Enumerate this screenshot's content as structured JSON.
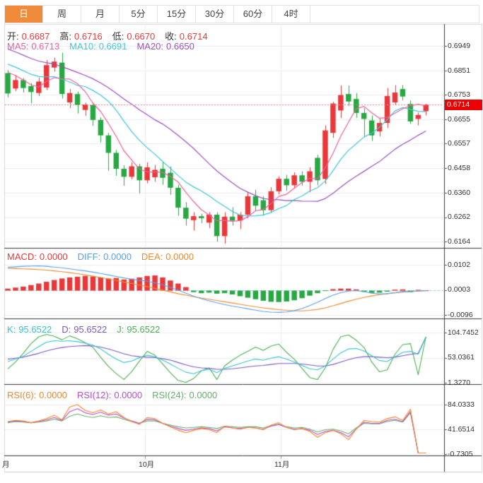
{
  "tabs": [
    {
      "label": "日",
      "selected": true
    },
    {
      "label": "周",
      "selected": false
    },
    {
      "label": "月",
      "selected": false
    },
    {
      "label": "5分",
      "selected": false
    },
    {
      "label": "15分",
      "selected": false
    },
    {
      "label": "30分",
      "selected": false
    },
    {
      "label": "60分",
      "selected": false
    },
    {
      "label": "4时",
      "selected": false
    }
  ],
  "main_panel": {
    "ohlc": {
      "open_label": "开:",
      "open": "0.6687",
      "high_label": "高:",
      "high": "0.6716",
      "low_label": "低:",
      "low": "0.6670",
      "close_label": "收:",
      "close": "0.6714"
    },
    "ma": {
      "ma5_label": "MA5:",
      "ma5": "0.6713",
      "ma10_label": "MA10:",
      "ma10": "0.6691",
      "ma20_label": "MA20:",
      "ma20": "0.6650"
    },
    "axis": [
      "0.6949",
      "0.6851",
      "0.6753",
      "0.6655",
      "0.6557",
      "0.6458",
      "0.6360",
      "0.6262",
      "0.6164"
    ],
    "current_price": "0.6714"
  },
  "macd_panel": {
    "row": {
      "macd_label": "MACD:",
      "macd": "0.0000",
      "diff_label": "DIFF:",
      "diff": "0.0000",
      "dea_label": "DEA:",
      "dea": "0.0000"
    },
    "axis": [
      "0.0102",
      "0.0003",
      "-0.0096"
    ]
  },
  "kdj_panel": {
    "row": {
      "k_label": "K:",
      "k": "95.6522",
      "d_label": "D:",
      "d": "95.6522",
      "j_label": "J:",
      "j": "95.6522"
    },
    "axis": [
      "104.7452",
      "53.0361",
      "1.3270"
    ]
  },
  "rsi_panel": {
    "row": {
      "rsi6_label": "RSI(6):",
      "rsi6": "0.0000",
      "rsi12_label": "RSI(12):",
      "rsi12": "0.0000",
      "rsi24_label": "RSI(24):",
      "rsi24": "0.0000"
    },
    "axis": [
      "84.0333",
      "41.6514",
      "-0.7305"
    ]
  },
  "x_axis": {
    "labels": [
      "月",
      "10月",
      "11月"
    ]
  },
  "colors": {
    "up": "#e8393a",
    "down": "#27a843",
    "tab_accent": "#ef8b3a",
    "price_tag_bg": "#ee0000",
    "dotted_price_line": "#f07a7a",
    "grid": "#eaeef2",
    "panel_border_dark": "#3a3a3a",
    "frame_light": "#d9d9d9",
    "ma5": "#ef5e9e",
    "ma10": "#3ec6da",
    "ma20": "#9b51c0",
    "diff": "#5aa0e6",
    "dea": "#f08a2c",
    "macd_zero_dash": "#8ed6e8",
    "k": "#35c3cf",
    "d": "#7e57c2",
    "j": "#4caf50",
    "rsi6": "#f5862e",
    "rsi12": "#b84fc9",
    "rsi24": "#66b06a"
  },
  "chart_data": {
    "type": "candlestick",
    "panels": [
      "price+MA",
      "MACD",
      "KDJ",
      "RSI"
    ],
    "x_axis_labels": [
      "月",
      "10月",
      "11月"
    ],
    "price_axis_ticks": [
      0.6949,
      0.6851,
      0.6753,
      0.6655,
      0.6557,
      0.6458,
      0.636,
      0.6262,
      0.6164
    ],
    "current_price": 0.6714,
    "ohlc_readout": {
      "open": 0.6687,
      "high": 0.6716,
      "low": 0.667,
      "close": 0.6714
    },
    "ma_readout": {
      "ma5": 0.6713,
      "ma10": 0.6691,
      "ma20": 0.665
    },
    "candles": [
      [
        0.684,
        0.6852,
        0.6742,
        0.6758
      ],
      [
        0.6778,
        0.6832,
        0.6768,
        0.6812
      ],
      [
        0.6812,
        0.682,
        0.6762,
        0.678
      ],
      [
        0.6788,
        0.68,
        0.6718,
        0.6764
      ],
      [
        0.676,
        0.6822,
        0.6748,
        0.6806
      ],
      [
        0.6782,
        0.6892,
        0.6772,
        0.6872
      ],
      [
        0.6862,
        0.6902,
        0.6846,
        0.6886
      ],
      [
        0.6882,
        0.6922,
        0.6738,
        0.6756
      ],
      [
        0.6722,
        0.6776,
        0.67,
        0.676
      ],
      [
        0.6756,
        0.6766,
        0.6678,
        0.6712
      ],
      [
        0.6692,
        0.6722,
        0.6668,
        0.6714
      ],
      [
        0.6712,
        0.6722,
        0.6628,
        0.6652
      ],
      [
        0.6652,
        0.6662,
        0.6562,
        0.659
      ],
      [
        0.659,
        0.66,
        0.6448,
        0.652
      ],
      [
        0.652,
        0.6532,
        0.6428,
        0.6456
      ],
      [
        0.6456,
        0.647,
        0.6388,
        0.6424
      ],
      [
        0.6424,
        0.6482,
        0.6414,
        0.6466
      ],
      [
        0.6466,
        0.6476,
        0.6358,
        0.641
      ],
      [
        0.641,
        0.6482,
        0.6398,
        0.6462
      ],
      [
        0.6422,
        0.6472,
        0.6404,
        0.6452
      ],
      [
        0.6456,
        0.6482,
        0.6392,
        0.642
      ],
      [
        0.644,
        0.6466,
        0.6352,
        0.638
      ],
      [
        0.638,
        0.6392,
        0.6268,
        0.63
      ],
      [
        0.63,
        0.6322,
        0.6228,
        0.6256
      ],
      [
        0.625,
        0.6282,
        0.6208,
        0.6266
      ],
      [
        0.6266,
        0.6276,
        0.6238,
        0.6258
      ],
      [
        0.624,
        0.6282,
        0.6218,
        0.6272
      ],
      [
        0.6272,
        0.6282,
        0.6164,
        0.6186
      ],
      [
        0.6186,
        0.6282,
        0.6156,
        0.6264
      ],
      [
        0.6264,
        0.6302,
        0.6228,
        0.6248
      ],
      [
        0.6248,
        0.6282,
        0.6214,
        0.6272
      ],
      [
        0.6272,
        0.6362,
        0.6258,
        0.6346
      ],
      [
        0.6346,
        0.6372,
        0.6288,
        0.6308
      ],
      [
        0.633,
        0.6346,
        0.6268,
        0.629
      ],
      [
        0.629,
        0.6382,
        0.628,
        0.6366
      ],
      [
        0.6366,
        0.6426,
        0.6354,
        0.6416
      ],
      [
        0.6416,
        0.6432,
        0.6368,
        0.639
      ],
      [
        0.639,
        0.6442,
        0.6378,
        0.643
      ],
      [
        0.643,
        0.6446,
        0.6388,
        0.6404
      ],
      [
        0.6404,
        0.6462,
        0.6362,
        0.6446
      ],
      [
        0.65,
        0.6512,
        0.639,
        0.641
      ],
      [
        0.6415,
        0.663,
        0.6395,
        0.661
      ],
      [
        0.66,
        0.6725,
        0.658,
        0.6718
      ],
      [
        0.669,
        0.679,
        0.666,
        0.6752
      ],
      [
        0.6756,
        0.679,
        0.6708,
        0.6726
      ],
      [
        0.6736,
        0.676,
        0.666,
        0.668
      ],
      [
        0.668,
        0.67,
        0.6586,
        0.6656
      ],
      [
        0.665,
        0.667,
        0.6568,
        0.659
      ],
      [
        0.6606,
        0.6656,
        0.6586,
        0.664
      ],
      [
        0.664,
        0.678,
        0.662,
        0.6748
      ],
      [
        0.6722,
        0.6792,
        0.6712,
        0.6762
      ],
      [
        0.6776,
        0.6792,
        0.673,
        0.6746
      ],
      [
        0.6716,
        0.673,
        0.6636,
        0.6646
      ],
      [
        0.6656,
        0.6682,
        0.663,
        0.6672
      ],
      [
        0.6687,
        0.6716,
        0.667,
        0.6714
      ]
    ],
    "ma_seed_closes": [
      0.706,
      0.705,
      0.704,
      0.7028,
      0.7016,
      0.7004,
      0.6992,
      0.698,
      0.6968,
      0.6956,
      0.6944,
      0.6932,
      0.692,
      0.6908,
      0.6896,
      0.6886,
      0.6876,
      0.6868,
      0.686,
      0.6852
    ],
    "indicators": {
      "macd": {
        "axis": [
          0.0102,
          0.0003,
          -0.0096
        ],
        "hist": [
          0.0008,
          0.0012,
          0.0016,
          0.0022,
          0.0028,
          0.0035,
          0.0042,
          0.0048,
          0.0052,
          0.0055,
          0.0058,
          0.0056,
          0.0052,
          0.0048,
          0.005,
          0.0044,
          0.0047,
          0.0052,
          0.0058,
          0.006,
          0.0052,
          0.004,
          0.0028,
          0.0014,
          -0.0006,
          -0.001,
          -0.0008,
          -0.0012,
          -0.001,
          -0.0015,
          -0.0022,
          -0.0028,
          -0.0034,
          -0.004,
          -0.0044,
          -0.0045,
          -0.0043,
          -0.0038,
          -0.003,
          -0.002,
          -0.001,
          -0.0002,
          0.0006,
          0.0008,
          0.0008,
          0.0005,
          -0.0005,
          -0.0009,
          -0.0008,
          -0.0004,
          0.0004,
          0.0005,
          -0.0006,
          0.0002,
          0.0
        ],
        "diff": [
          0.0092,
          0.0094,
          0.0096,
          0.0097,
          0.0098,
          0.0096,
          0.0093,
          0.009,
          0.0086,
          0.0082,
          0.0078,
          0.0073,
          0.0068,
          0.0062,
          0.0056,
          0.005,
          0.0045,
          0.0041,
          0.0037,
          0.0031,
          0.0023,
          0.0013,
          0.0002,
          -0.001,
          -0.0022,
          -0.0032,
          -0.004,
          -0.0048,
          -0.0055,
          -0.0061,
          -0.0066,
          -0.0072,
          -0.0077,
          -0.0082,
          -0.0085,
          -0.0086,
          -0.0084,
          -0.0079,
          -0.0071,
          -0.0059,
          -0.0046,
          -0.0031,
          -0.0018,
          -0.0008,
          -0.0002,
          0.0,
          -0.0004,
          -0.001,
          -0.0013,
          -0.0012,
          -0.0008,
          -0.0003,
          -0.0004,
          -0.0001,
          0.0
        ],
        "dea": [
          0.0088,
          0.0087,
          0.0086,
          0.0085,
          0.0083,
          0.0081,
          0.0078,
          0.0075,
          0.0071,
          0.0067,
          0.0062,
          0.0057,
          0.0052,
          0.0046,
          0.004,
          0.0034,
          0.0028,
          0.0022,
          0.0016,
          0.0009,
          0.0002,
          -0.0005,
          -0.0012,
          -0.0018,
          -0.0024,
          -0.0029,
          -0.0034,
          -0.0039,
          -0.0044,
          -0.0049,
          -0.0054,
          -0.0059,
          -0.0064,
          -0.0068,
          -0.0072,
          -0.0075,
          -0.0078,
          -0.008,
          -0.008,
          -0.0078,
          -0.0074,
          -0.0068,
          -0.006,
          -0.0051,
          -0.0042,
          -0.0034,
          -0.0027,
          -0.0021,
          -0.0016,
          -0.0012,
          -0.0009,
          -0.0006,
          -0.0004,
          -0.0002,
          0.0
        ]
      },
      "kdj": {
        "axis": [
          104.7452,
          53.0361,
          1.327
        ],
        "k": [
          45,
          50,
          56,
          66,
          76,
          85,
          88,
          87,
          88,
          86,
          83,
          79,
          71,
          60,
          50,
          43,
          46,
          53,
          58,
          55,
          48,
          40,
          31,
          23,
          20,
          26,
          29,
          22,
          31,
          36,
          41,
          46,
          50,
          48,
          52,
          55,
          50,
          44,
          37,
          30,
          28,
          36,
          50,
          63,
          71,
          72,
          67,
          57,
          47,
          45,
          55,
          64,
          66,
          60,
          95.65
        ],
        "d": [
          50,
          52,
          54,
          58,
          62,
          67,
          71,
          74,
          76,
          77,
          78,
          77,
          75,
          71,
          66,
          61,
          57,
          55,
          54,
          53,
          51,
          48,
          43,
          38,
          34,
          32,
          31,
          29,
          29,
          30,
          32,
          34,
          36,
          37,
          39,
          41,
          41,
          41,
          40,
          38,
          36,
          36,
          39,
          44,
          49,
          53,
          55,
          55,
          54,
          53,
          54,
          57,
          60,
          62,
          95.65
        ],
        "j": [
          30,
          44,
          62,
          82,
          96,
          101,
          97,
          90,
          98,
          92,
          84,
          74,
          54,
          35,
          20,
          8,
          24,
          46,
          66,
          58,
          40,
          22,
          6,
          2,
          10,
          26,
          32,
          8,
          36,
          48,
          58,
          66,
          75,
          68,
          77,
          81,
          64,
          50,
          31,
          12,
          8,
          32,
          70,
          96,
          100,
          89,
          74,
          44,
          24,
          28,
          60,
          80,
          82,
          18,
          95.65
        ]
      },
      "rsi": {
        "axis": [
          84.0333,
          41.6514,
          -0.7305
        ],
        "rsi6": [
          55,
          57,
          56,
          53,
          56,
          60,
          66,
          58,
          80,
          84,
          74,
          70,
          75,
          68,
          72,
          62,
          55,
          50,
          62,
          60,
          52,
          46,
          40,
          36,
          40,
          43,
          41,
          36,
          47,
          44,
          42,
          45,
          44,
          41,
          49,
          53,
          45,
          41,
          43,
          38,
          28,
          36,
          40,
          34,
          24,
          42,
          57,
          55,
          54,
          60,
          63,
          57,
          76,
          1,
          1
        ],
        "rsi12": [
          54,
          56,
          55,
          53,
          55,
          58,
          62,
          57,
          72,
          77,
          70,
          67,
          71,
          66,
          68,
          61,
          56,
          52,
          59,
          58,
          52,
          47,
          43,
          40,
          42,
          44,
          43,
          39,
          46,
          44,
          43,
          45,
          44,
          42,
          47,
          50,
          45,
          42,
          43,
          40,
          33,
          38,
          40,
          36,
          29,
          42,
          54,
          52,
          52,
          57,
          59,
          55,
          72,
          1,
          1
        ],
        "rsi24": [
          53,
          55,
          54,
          53,
          54,
          56,
          59,
          56,
          64,
          68,
          64,
          62,
          65,
          62,
          63,
          59,
          55,
          52,
          56,
          56,
          52,
          49,
          46,
          44,
          45,
          46,
          45,
          43,
          47,
          46,
          45,
          46,
          46,
          44,
          48,
          50,
          46,
          44,
          45,
          42,
          37,
          41,
          42,
          39,
          34,
          44,
          52,
          51,
          51,
          55,
          57,
          54,
          70,
          1,
          1
        ]
      }
    }
  }
}
